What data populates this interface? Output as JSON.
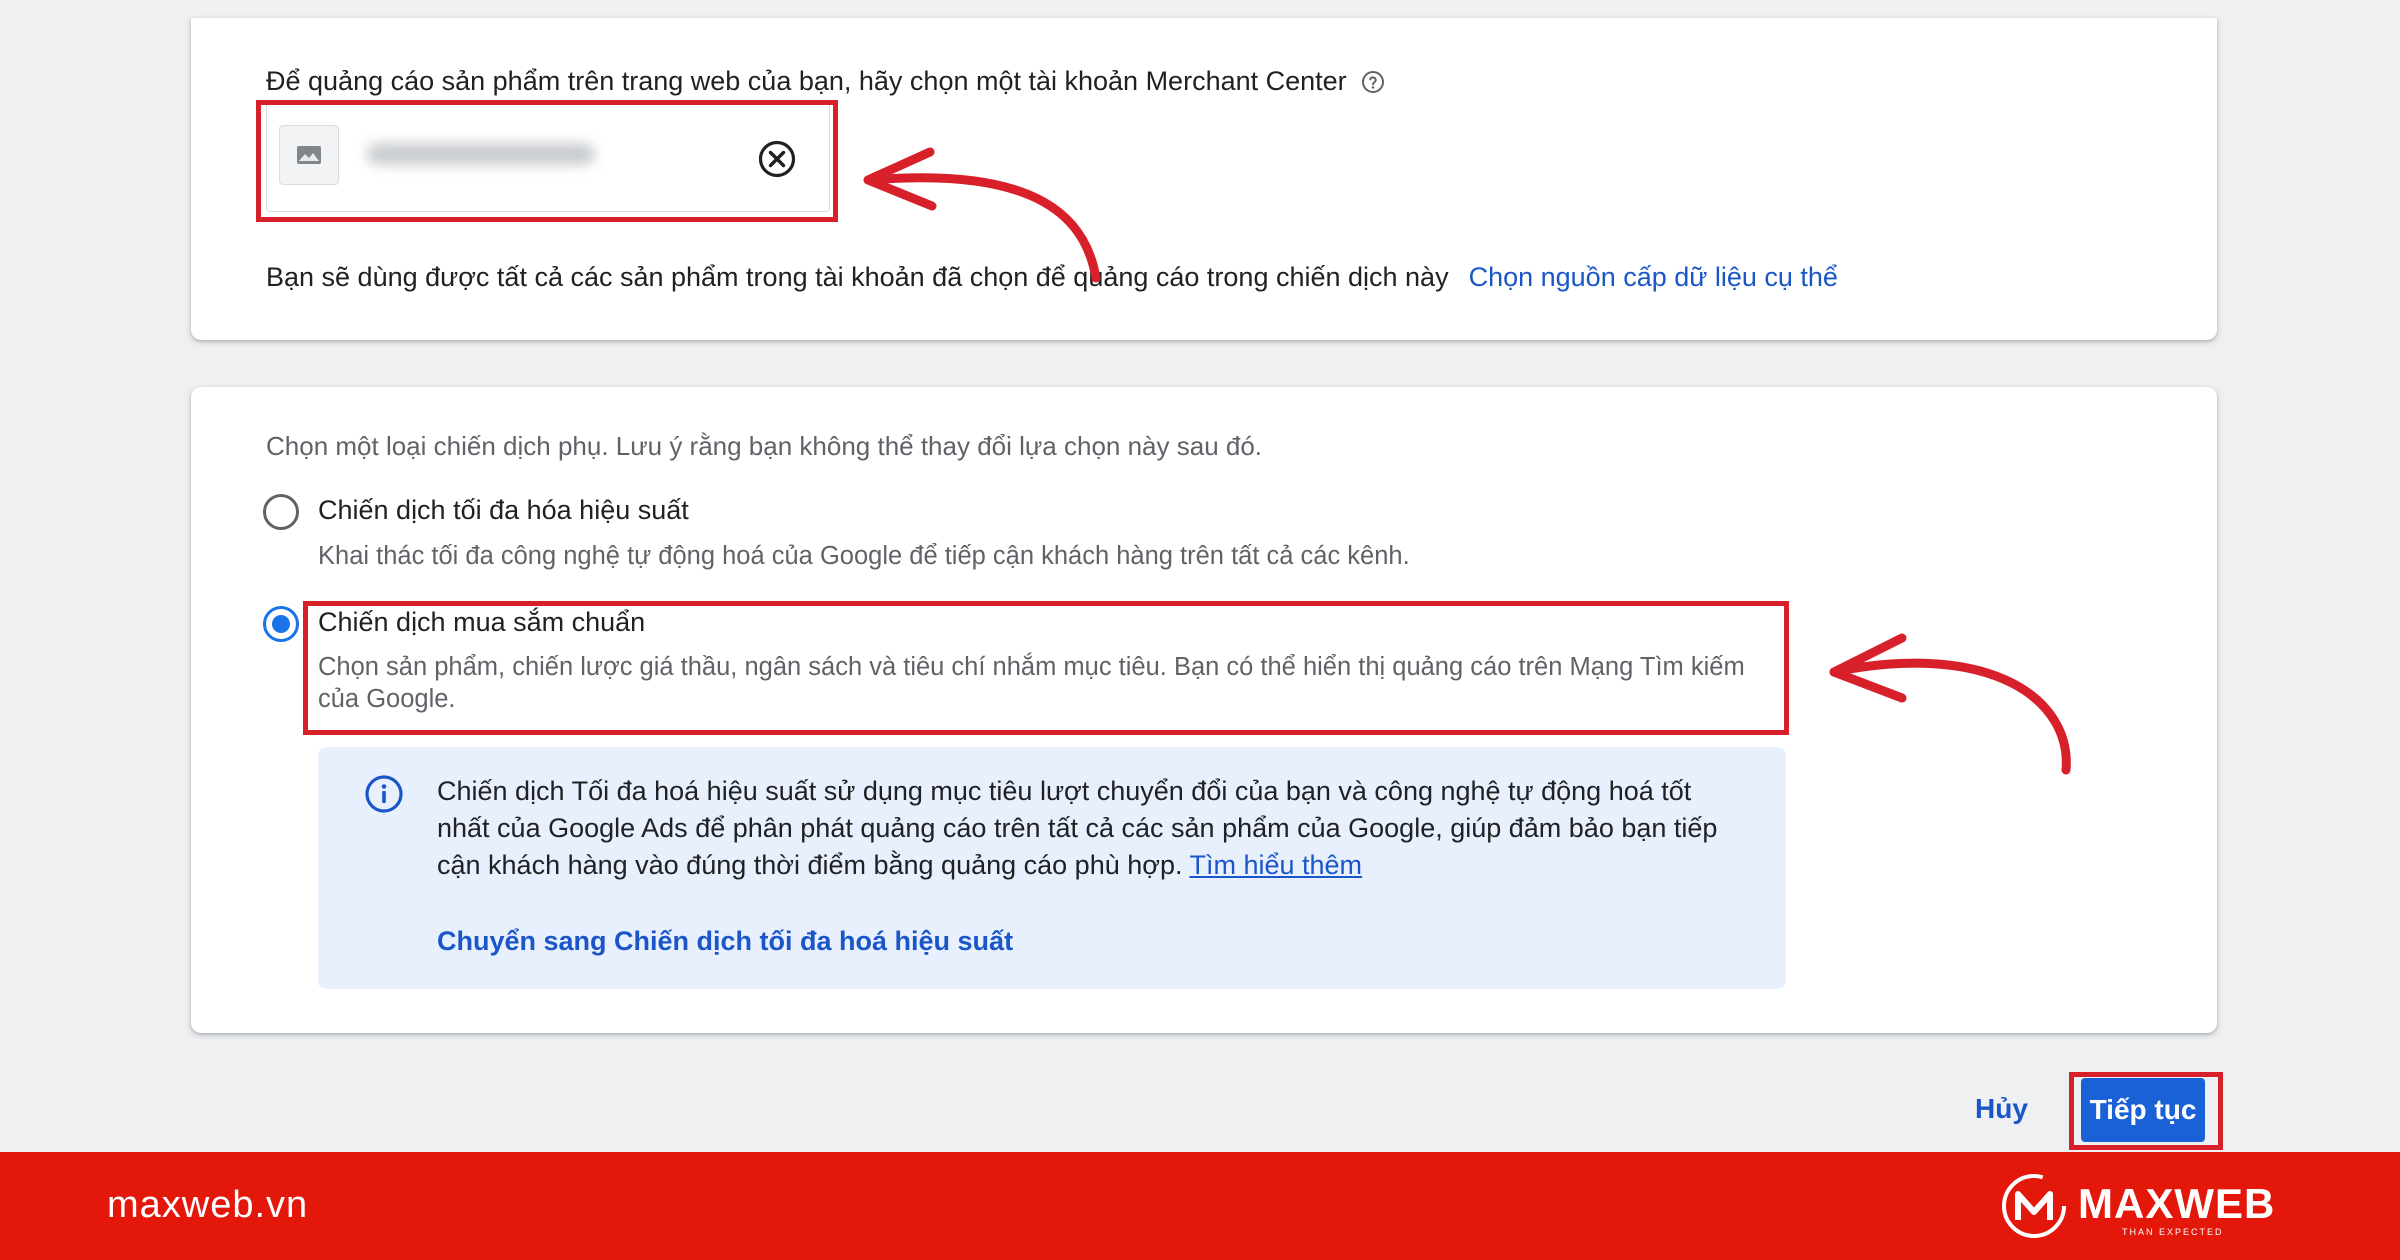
{
  "merchant": {
    "prompt": "Để quảng cáo sản phẩm trên trang web của bạn, hãy chọn một tài khoản Merchant Center",
    "account_name": "",
    "products_note": "Bạn sẽ dùng được tất cả các sản phẩm trong tài khoản đã chọn để quảng cáo trong chiến dịch này",
    "feed_link": "Chọn nguồn cấp dữ liệu cụ thể"
  },
  "subtype": {
    "prompt": "Chọn một loại chiến dịch phụ. Lưu ý rằng bạn không thể thay đổi lựa chọn này sau đó.",
    "options": [
      {
        "title": "Chiến dịch tối đa hóa hiệu suất",
        "description": "Khai thác tối đa công nghệ tự động hoá của Google để tiếp cận khách hàng trên tất cả các kênh.",
        "selected": false
      },
      {
        "title": "Chiến dịch mua sắm chuẩn",
        "description": "Chọn sản phẩm, chiến lược giá thầu, ngân sách và tiêu chí nhắm mục tiêu. Bạn có thể hiển thị quảng cáo trên Mạng Tìm kiếm của Google.",
        "selected": true
      }
    ],
    "info": {
      "text": "Chiến dịch Tối đa hoá hiệu suất sử dụng mục tiêu lượt chuyển đổi của bạn và công nghệ tự động hoá tốt nhất của Google Ads để phân phát quảng cáo trên tất cả các sản phẩm của Google, giúp đảm bảo bạn tiếp cận khách hàng vào đúng thời điểm bằng quảng cáo phù hợp.",
      "learn_more": "Tìm hiểu thêm",
      "switch_link": "Chuyển sang Chiến dịch tối đa hoá hiệu suất"
    }
  },
  "actions": {
    "cancel": "Hủy",
    "continue": "Tiếp tục"
  },
  "footer": {
    "site": "maxweb.vn",
    "brand": "MAXWEB",
    "tagline": "THAN EXPECTED"
  },
  "colors": {
    "annotation_red": "#d8202a",
    "link_blue": "#1a56c8",
    "primary_blue": "#1a61d8",
    "radio_blue": "#1a73e8",
    "info_bg": "#e8f0fe",
    "footer_red": "#e3170a"
  }
}
